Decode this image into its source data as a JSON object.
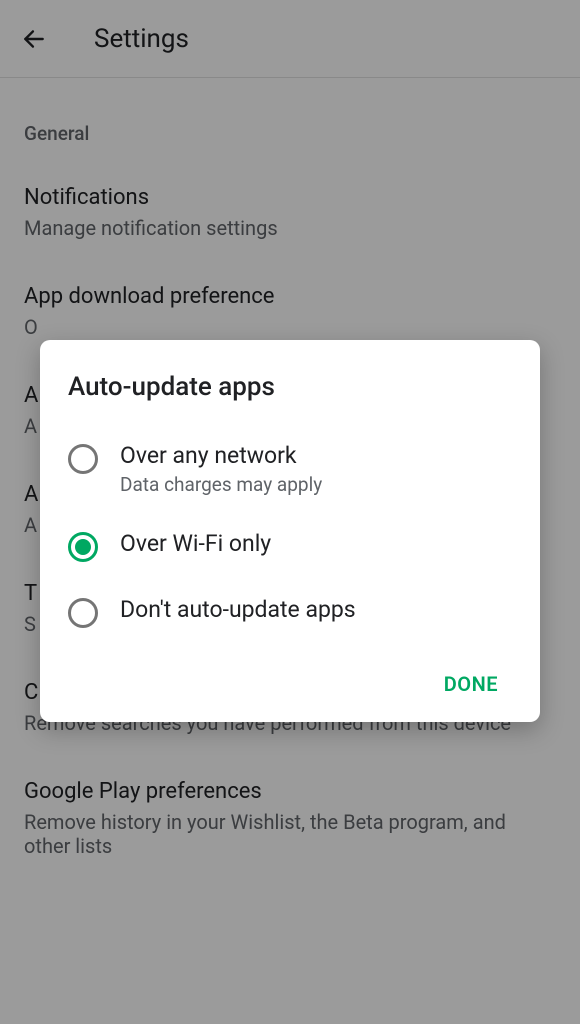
{
  "header": {
    "title": "Settings"
  },
  "sections": {
    "general_label": "General",
    "items": [
      {
        "title": "Notifications",
        "subtitle": "Manage notification settings"
      },
      {
        "title": "App download preference",
        "subtitle": "O"
      },
      {
        "title": "A",
        "subtitle": "A"
      },
      {
        "title": "A",
        "subtitle": "A"
      },
      {
        "title": "T",
        "subtitle": "S"
      },
      {
        "title": "Clear local search history",
        "subtitle": "Remove searches you have performed from this device"
      },
      {
        "title": "Google Play preferences",
        "subtitle": "Remove history in your Wishlist, the Beta program, and other lists"
      }
    ]
  },
  "dialog": {
    "title": "Auto-update apps",
    "options": [
      {
        "label": "Over any network",
        "sublabel": "Data charges may apply",
        "selected": false
      },
      {
        "label": "Over Wi-Fi only",
        "sublabel": "",
        "selected": true
      },
      {
        "label": "Don't auto-update apps",
        "sublabel": "",
        "selected": false
      }
    ],
    "done_label": "DONE"
  },
  "colors": {
    "accent": "#00a862"
  }
}
